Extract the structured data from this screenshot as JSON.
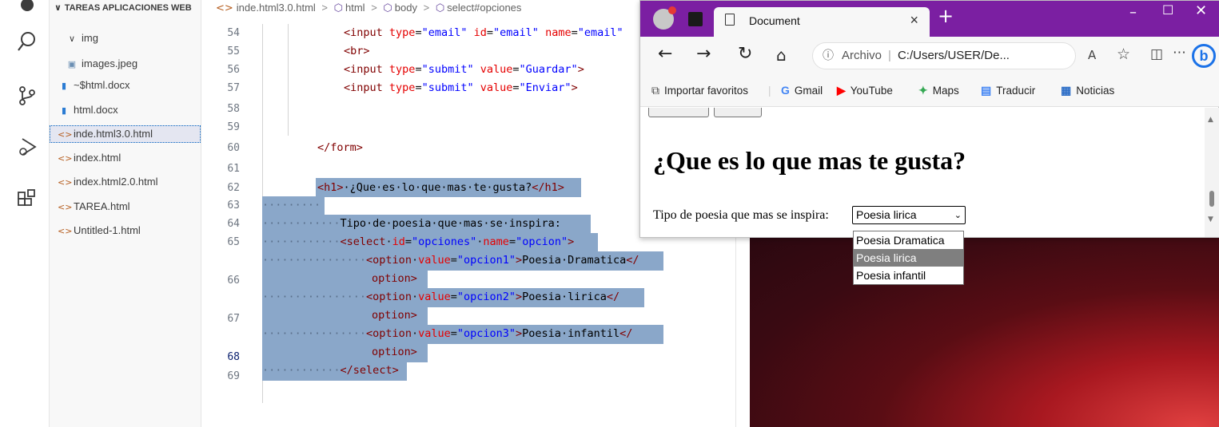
{
  "activity_bar": {
    "icons": [
      "explorer-icon",
      "search-icon",
      "source-control-icon",
      "run-debug-icon",
      "extensions-icon"
    ]
  },
  "explorer": {
    "root_label": "TAREAS APLICACIONES WEB",
    "folder": "img",
    "files": [
      {
        "name": "images.jpeg",
        "icon": "image-icon"
      },
      {
        "name": "~$html.docx",
        "icon": "word-icon"
      },
      {
        "name": "html.docx",
        "icon": "word-icon"
      },
      {
        "name": "inde.html3.0.html",
        "icon": "html-icon",
        "selected": true
      },
      {
        "name": "index.html",
        "icon": "html-icon"
      },
      {
        "name": "index.html2.0.html",
        "icon": "html-icon"
      },
      {
        "name": "TAREA.html",
        "icon": "html-icon"
      },
      {
        "name": "Untitled-1.html",
        "icon": "html-icon"
      }
    ]
  },
  "breadcrumb": {
    "file": "inde.html3.0.html",
    "html": "html",
    "body": "body",
    "select": "select#opciones"
  },
  "editor": {
    "line_numbers": [
      "54",
      "55",
      "56",
      "57",
      "58",
      "59",
      "60",
      "61",
      "62",
      "63",
      "64",
      "65",
      "66",
      "67",
      "68",
      "69"
    ],
    "active_line": "68"
  },
  "browser": {
    "tab_title": "Document",
    "url_label": "Archivo",
    "url": "C:/Users/USER/De...",
    "favorites": {
      "import": "Importar favoritos",
      "gmail": "Gmail",
      "youtube": "YouTube",
      "maps": "Maps",
      "traducir": "Traducir",
      "noticias": "Noticias"
    },
    "page": {
      "heading": "¿Que es lo que mas te gusta?",
      "prompt": "Tipo de poesia que mas se inspira:",
      "select_value": "Poesia lirica",
      "options": [
        "Poesia Dramatica",
        "Poesia lirica",
        "Poesia infantil"
      ],
      "selected_option_index": 1
    }
  },
  "colors": {
    "browser_titlebar": "#7b1fa2",
    "selection": "#8aa7c9",
    "tag": "#800000",
    "attribute": "#e50000",
    "attribute_value": "#0000ff"
  }
}
